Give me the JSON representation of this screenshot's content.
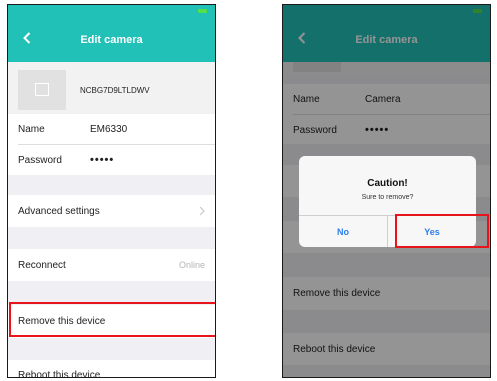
{
  "left_screen": {
    "title": "Edit camera",
    "device_id": "NCBG7D9LTLDWV",
    "name_label": "Name",
    "name_value": "EM6330",
    "password_label": "Password",
    "password_value": "•••••",
    "advanced_settings_label": "Advanced settings",
    "reconnect_label": "Reconnect",
    "reconnect_status": "Online",
    "remove_label": "Remove this device",
    "reboot_label": "Reboot this device"
  },
  "right_screen": {
    "title": "Edit camera",
    "name_label": "Name",
    "name_value": "Camera",
    "password_label": "Password",
    "password_value": "•••••",
    "remove_label": "Remove this device",
    "reboot_label": "Reboot this device",
    "dialog": {
      "title": "Caution!",
      "message": "Sure to remove?",
      "no_label": "No",
      "yes_label": "Yes"
    }
  },
  "colors": {
    "nav_bar": "#21c1b7",
    "highlight": "#e8141c",
    "dialog_button": "#2a7ff0"
  }
}
